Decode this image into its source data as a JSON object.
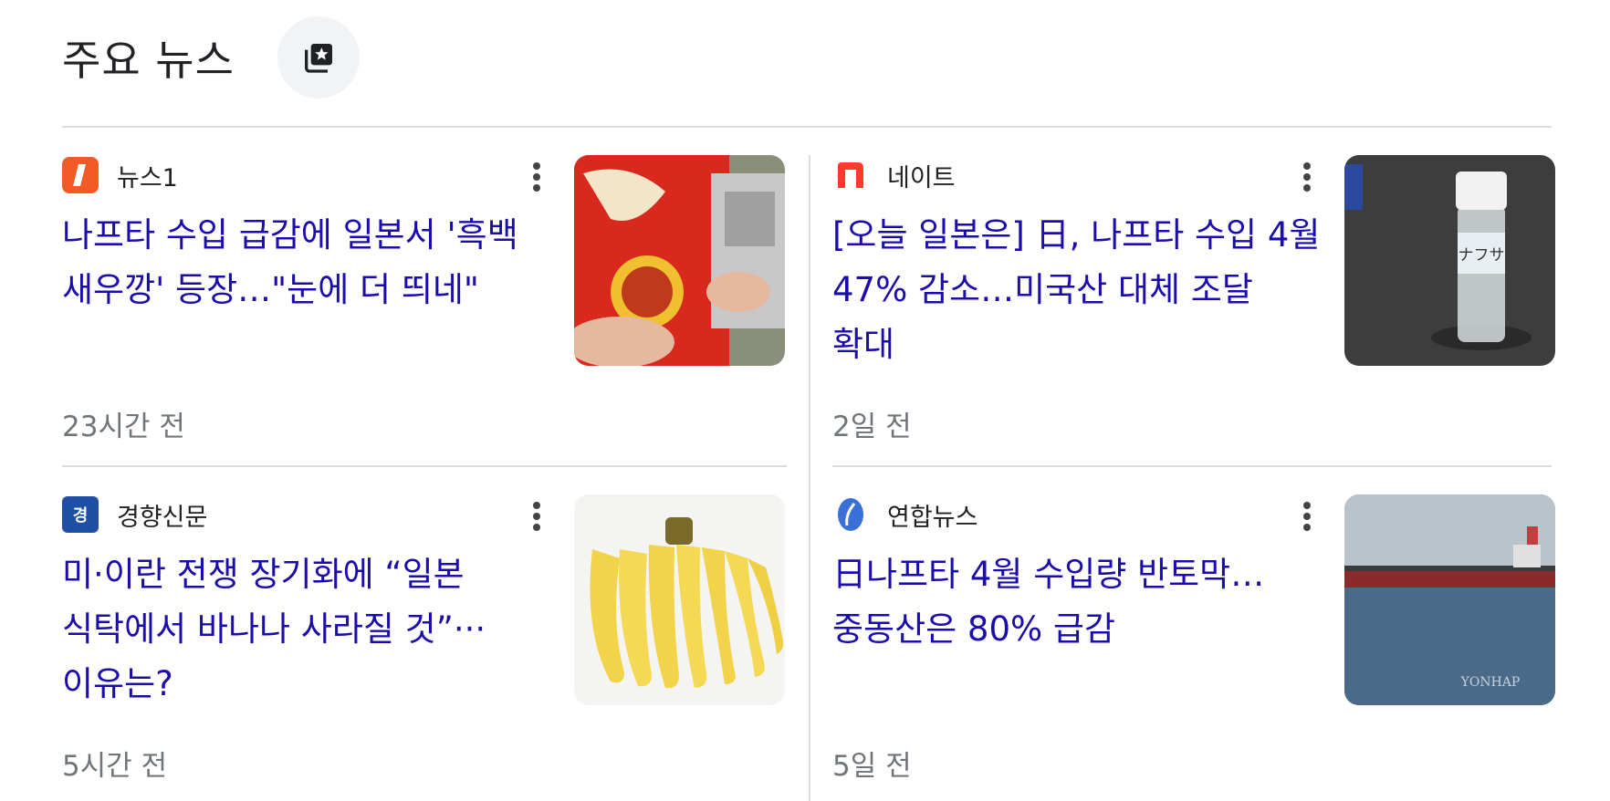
{
  "header": {
    "title": "주요 뉴스",
    "button_icon": "star-stack-icon"
  },
  "articles": [
    {
      "source": "뉴스1",
      "headline": "나프타 수입 급감에 일본서 '흑백 새우깡' 등장…\"눈에 더 띄네\"",
      "time": "23시간 전",
      "thumb": "snack-bags-photo",
      "logo_color": "#f15a24"
    },
    {
      "source": "네이트",
      "headline": "[오늘 일본은] 日, 나프타 수입 4월 47% 감소…미국산 대체 조달 확대",
      "time": "2일 전",
      "thumb": "naphtha-bottle-photo",
      "logo_color": "#ff3b30"
    },
    {
      "source": "경향신문",
      "headline": "미·이란 전쟁 장기화에 “일본 식탁에서 바나나 사라질 것”···이유는?",
      "time": "5시간 전",
      "thumb": "bananas-photo",
      "logo_color": "#1e4fa3"
    },
    {
      "source": "연합뉴스",
      "headline": "日나프타 4월 수입량 반토막…중동산은 80% 급감",
      "time": "5일 전",
      "thumb": "tanker-ship-photo",
      "logo_color": "#3b6fd8"
    }
  ],
  "thumb_captions": {
    "naphtha_label": "ナフサ",
    "yonhap_watermark": "YONHAP"
  }
}
